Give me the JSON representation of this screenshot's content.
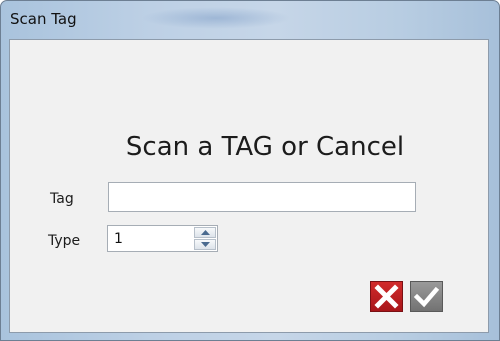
{
  "window": {
    "title": "Scan Tag"
  },
  "dialog": {
    "heading": "Scan a TAG or Cancel",
    "tag_label": "Tag",
    "tag_value": "",
    "type_label": "Type",
    "type_value": "1"
  },
  "buttons": {
    "cancel_icon": "red-x-icon",
    "ok_icon": "gray-checkmark-icon"
  },
  "colors": {
    "cancel_red": "#c4211f",
    "ok_gray": "#8a8a8a",
    "titlebar_blue": "#bdd0e5",
    "client_bg": "#f1f1f1"
  }
}
